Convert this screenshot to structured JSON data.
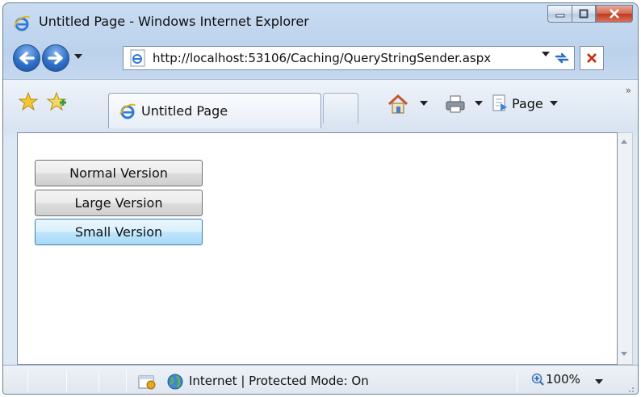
{
  "window": {
    "title": "Untitled Page - Windows Internet Explorer"
  },
  "navigation": {
    "address": "http://localhost:53106/Caching/QueryStringSender.aspx"
  },
  "tabs": [
    {
      "label": "Untitled Page",
      "active": true
    }
  ],
  "command_bar": {
    "page_menu_label": "Page"
  },
  "page": {
    "buttons": [
      {
        "label": "Normal Version",
        "focused": false
      },
      {
        "label": "Large Version",
        "focused": false
      },
      {
        "label": "Small Version",
        "focused": true
      }
    ]
  },
  "status_bar": {
    "zone": "Internet | Protected Mode: On",
    "zoom": "100%"
  },
  "colors": {
    "chrome_blue": "#bcd2ec",
    "close_red": "#c0381b",
    "focus_border": "#3c7fb1"
  }
}
